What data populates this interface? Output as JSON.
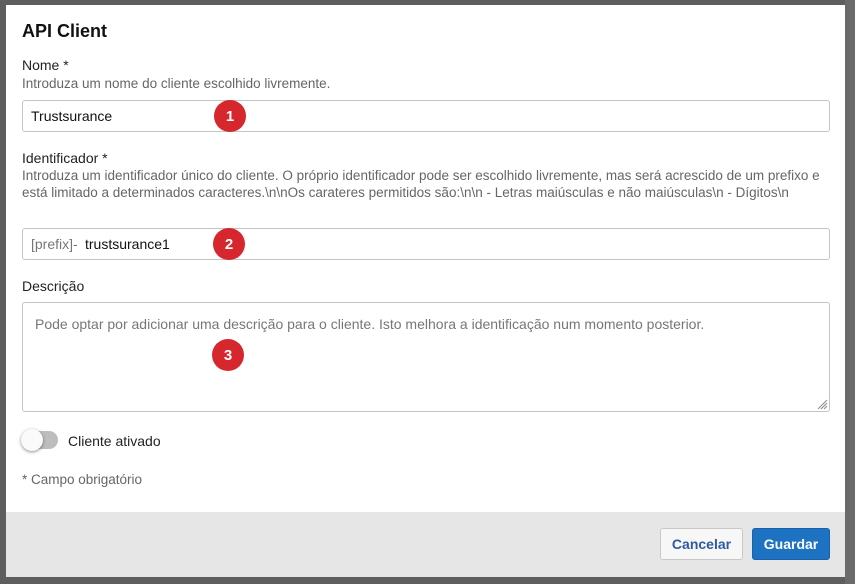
{
  "modal": {
    "title": "API Client"
  },
  "fields": {
    "name": {
      "label": "Nome *",
      "help": "Introduza um nome do cliente escolhido livremente.",
      "value": "Trustsurance",
      "marker": "1"
    },
    "identifier": {
      "label": "Identificador *",
      "help": "Introduza um identificador único do cliente. O próprio identificador pode ser escolhido livremente, mas será acrescido de um prefixo e está limitado a determinados caracteres.\\n\\nOs carateres permitidos são:\\n\\n - Letras maiúsculas e não maiúsculas\\n - Dígitos\\n",
      "prefix": "[prefix]-",
      "value": "trustsurance1",
      "marker": "2"
    },
    "description": {
      "label": "Descrição",
      "placeholder": "Pode optar por adicionar uma descrição para o cliente. Isto melhora a identificação num momento posterior.",
      "marker": "3"
    }
  },
  "toggle": {
    "label": "Cliente ativado",
    "on": false
  },
  "required_note": "* Campo obrigatório",
  "footer": {
    "cancel_label": "Cancelar",
    "save_label": "Guardar"
  },
  "colors": {
    "marker": "#d6272e",
    "primary": "#1e72c2",
    "link": "#2d5aa0",
    "footer_bg": "#e6e6e6"
  },
  "icons": {
    "resize": "resize-grip-icon"
  }
}
